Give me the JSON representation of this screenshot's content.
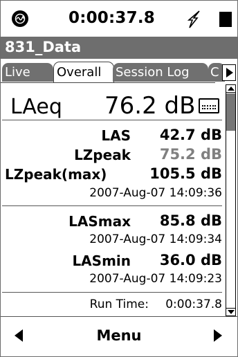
{
  "status": {
    "time": "0:00:37.8",
    "icons": {
      "logo": "instrument-logo-icon",
      "power": "external-power-icon",
      "battery": "battery-icon"
    }
  },
  "title": "831_Data",
  "tabs": [
    {
      "label": "Live",
      "active": false
    },
    {
      "label": "Overall",
      "active": true
    },
    {
      "label": "Session Log",
      "active": false
    },
    {
      "label": "C",
      "active": false
    }
  ],
  "laeq": {
    "label": "LAeq",
    "value": "76.2 dB"
  },
  "metrics": {
    "las": {
      "label": "LAS",
      "value": "42.7 dB"
    },
    "lzpeak": {
      "label": "LZpeak",
      "value": "75.2 dB"
    },
    "lzpeak_max": {
      "label": "LZpeak(max)",
      "value": "105.5 dB",
      "time": "2007-Aug-07 14:09:36"
    },
    "lasmax": {
      "label": "LASmax",
      "value": "85.8 dB",
      "time": "2007-Aug-07 14:09:34"
    },
    "lasmin": {
      "label": "LASmin",
      "value": "36.0 dB",
      "time": "2007-Aug-07 14:09:23"
    }
  },
  "run_time": {
    "label": "Run Time:",
    "value": "0:00:37.8"
  },
  "bottom": {
    "menu_label": "Menu"
  },
  "colors": {
    "title_bg": "#6e6e6e",
    "tab_inactive_bg": "#707070",
    "muted_value": "#808080"
  }
}
